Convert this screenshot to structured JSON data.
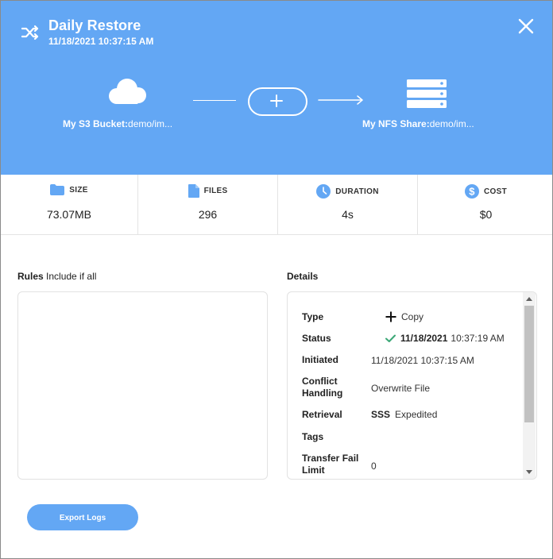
{
  "header": {
    "title": "Daily Restore",
    "timestamp": "11/18/2021 10:37:15 AM",
    "source": {
      "name": "My S3 Bucket:",
      "path": "demo/im..."
    },
    "destination": {
      "name": "My NFS Share:",
      "path": "demo/im..."
    }
  },
  "stats": [
    {
      "label": "SIZE",
      "value": "73.07MB",
      "icon": "folder-icon"
    },
    {
      "label": "FILES",
      "value": "296",
      "icon": "file-icon"
    },
    {
      "label": "DURATION",
      "value": "4s",
      "icon": "clock-icon"
    },
    {
      "label": "COST",
      "value": "$0",
      "icon": "dollar-icon"
    }
  ],
  "rules": {
    "label": "Rules",
    "sublabel": "Include if all"
  },
  "details": {
    "label": "Details",
    "rows": [
      {
        "key": "Type",
        "value": "Copy",
        "icon": "plus-icon"
      },
      {
        "key": "Status",
        "date": "11/18/2021",
        "time": "10:37:19 AM",
        "icon": "check-icon"
      },
      {
        "key": "Initiated",
        "value": "11/18/2021 10:37:15 AM"
      },
      {
        "key": "Conflict Handling",
        "value": "Overwrite File"
      },
      {
        "key": "Retrieval",
        "badge": "SSS",
        "value": "Expedited"
      },
      {
        "key": "Tags",
        "value": ""
      },
      {
        "key": "Transfer Fail Limit",
        "value": "0"
      }
    ]
  },
  "actions": {
    "export_label": "Export Logs"
  },
  "colors": {
    "accent": "#63a7f4",
    "success": "#3ba776"
  }
}
